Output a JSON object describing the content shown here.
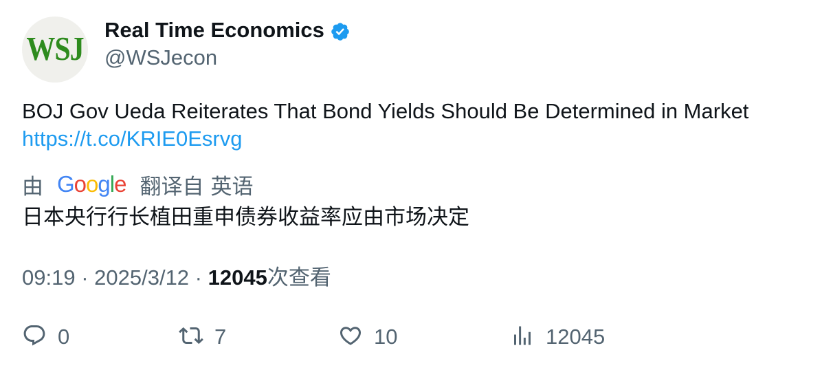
{
  "author": {
    "avatar_text": "WSJ",
    "display_name": "Real Time Economics",
    "handle": "@WSJecon",
    "verified": true,
    "avatar_bg": "#f0f0ec",
    "avatar_fg": "#2e8b1e"
  },
  "tweet": {
    "text": "BOJ Gov Ueda Reiterates That Bond Yields Should Be Determined in Market",
    "link": "https://t.co/KRIE0Esrvg"
  },
  "translation": {
    "by_label": "由",
    "provider": "Google",
    "translated_from_label": "翻译自",
    "source_language": "英语",
    "text": "日本央行行长植田重申债券收益率应由市场决定"
  },
  "meta": {
    "time": "09:19",
    "separator": " · ",
    "date": "2025/3/12",
    "views_count": "12045",
    "views_label": "次查看"
  },
  "actions": {
    "reply": {
      "icon": "reply-icon",
      "count": "0"
    },
    "retweet": {
      "icon": "retweet-icon",
      "count": "7"
    },
    "like": {
      "icon": "heart-icon",
      "count": "10"
    },
    "views": {
      "icon": "views-chart-icon",
      "count": "12045"
    }
  },
  "colors": {
    "text": "#0f1419",
    "secondary": "#536471",
    "link": "#1d9bf0",
    "verified": "#1d9bf0"
  }
}
